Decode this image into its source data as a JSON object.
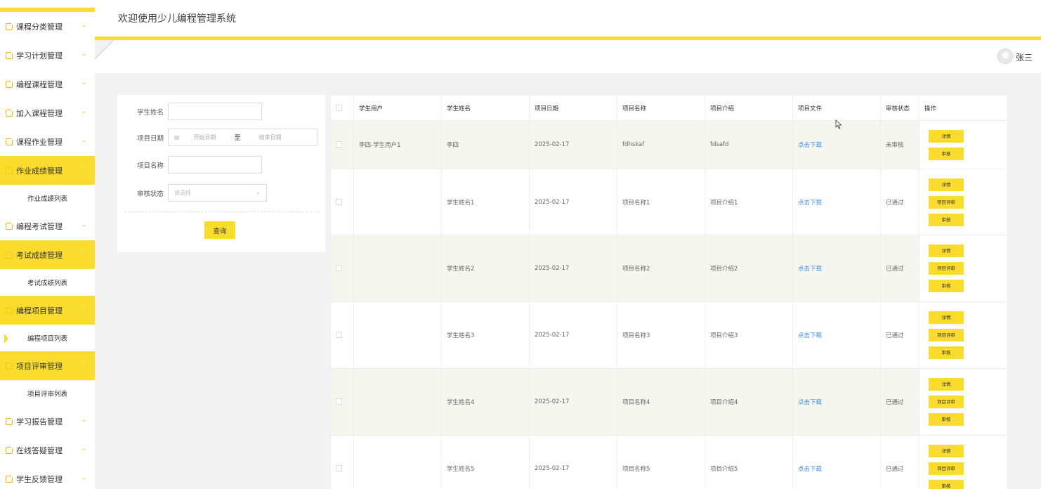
{
  "app": {
    "title": "欢迎使用少儿编程管理系统",
    "user_name": "张三"
  },
  "sidebar": {
    "items": [
      {
        "type": "menu",
        "label": "课程分类管理",
        "active": false
      },
      {
        "type": "menu",
        "label": "学习计划管理",
        "active": false
      },
      {
        "type": "menu",
        "label": "编程课程管理",
        "active": false
      },
      {
        "type": "menu",
        "label": "加入课程管理",
        "active": false
      },
      {
        "type": "menu",
        "label": "课程作业管理",
        "active": false
      },
      {
        "type": "menu",
        "label": "作业成绩管理",
        "active": true
      },
      {
        "type": "sub",
        "label": "作业成绩列表",
        "current": false
      },
      {
        "type": "menu",
        "label": "编程考试管理",
        "active": false
      },
      {
        "type": "menu",
        "label": "考试成绩管理",
        "active": true
      },
      {
        "type": "sub",
        "label": "考试成绩列表",
        "current": false
      },
      {
        "type": "menu",
        "label": "编程项目管理",
        "active": true
      },
      {
        "type": "sub",
        "label": "编程项目列表",
        "current": true
      },
      {
        "type": "menu",
        "label": "项目评审管理",
        "active": true
      },
      {
        "type": "sub",
        "label": "项目评审列表",
        "current": false
      },
      {
        "type": "menu",
        "label": "学习报告管理",
        "active": false
      },
      {
        "type": "menu",
        "label": "在线答疑管理",
        "active": false
      },
      {
        "type": "menu",
        "label": "学生反馈管理",
        "active": false
      }
    ]
  },
  "search": {
    "student_name_label": "学生姓名",
    "project_date_label": "项目日期",
    "start_date_placeholder": "开始日期",
    "date_separator": "至",
    "end_date_placeholder": "结束日期",
    "project_name_label": "项目名称",
    "review_status_label": "审核状态",
    "review_status_placeholder": "请选择",
    "query_button": "查询"
  },
  "table": {
    "columns": [
      "学生用户",
      "学生姓名",
      "项目日期",
      "项目名称",
      "项目介绍",
      "项目文件",
      "审核状态",
      "操作"
    ],
    "rows": [
      {
        "user": "李四-学生用户1",
        "name": "李四",
        "date": "2025-02-17",
        "project": "fdhskaf",
        "intro": "fdsafd",
        "file": "点击下载",
        "status": "未审核",
        "actions": [
          "详情",
          "审核"
        ]
      },
      {
        "user": "",
        "name": "学生姓名1",
        "date": "2025-02-17",
        "project": "项目名称1",
        "intro": "项目介绍1",
        "file": "点击下载",
        "status": "已通过",
        "actions": [
          "详情",
          "项目评审",
          "审核"
        ]
      },
      {
        "user": "",
        "name": "学生姓名2",
        "date": "2025-02-17",
        "project": "项目名称2",
        "intro": "项目介绍2",
        "file": "点击下载",
        "status": "已通过",
        "actions": [
          "详情",
          "项目评审",
          "审核"
        ]
      },
      {
        "user": "",
        "name": "学生姓名3",
        "date": "2025-02-17",
        "project": "项目名称3",
        "intro": "项目介绍3",
        "file": "点击下载",
        "status": "已通过",
        "actions": [
          "详情",
          "项目评审",
          "审核"
        ]
      },
      {
        "user": "",
        "name": "学生姓名4",
        "date": "2025-02-17",
        "project": "项目名称4",
        "intro": "项目介绍4",
        "file": "点击下载",
        "status": "已通过",
        "actions": [
          "详情",
          "项目评审",
          "审核"
        ]
      },
      {
        "user": "",
        "name": "学生姓名5",
        "date": "2025-02-17",
        "project": "项目名称5",
        "intro": "项目介绍5",
        "file": "点击下载",
        "status": "已通过",
        "actions": [
          "详情",
          "项目评审",
          "审核"
        ]
      }
    ]
  },
  "colors": {
    "accent": "#fadc2f",
    "link": "#3a8ee6",
    "row_highlight": "#f5f6ef",
    "page_bg": "#f2f2f2"
  },
  "icons": {
    "menu_item": "file-edit-icon",
    "chevron": "chevron-down-icon",
    "user": "user-avatar-icon",
    "calendar": "calendar-icon"
  }
}
